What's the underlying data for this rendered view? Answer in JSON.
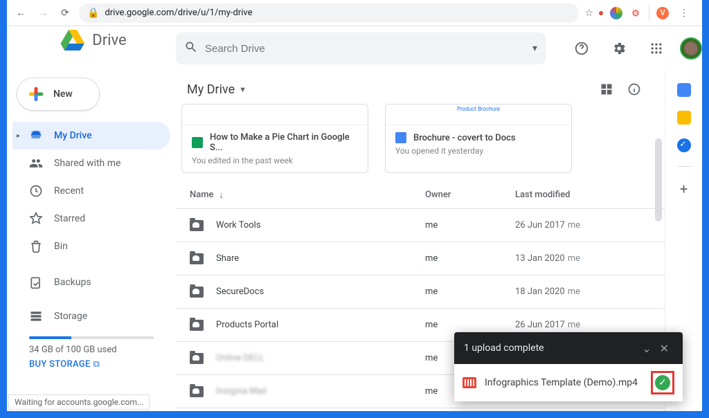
{
  "browser": {
    "url": "drive.google.com/drive/u/1/my-drive",
    "avatar_letter": "V",
    "status": "Waiting for accounts.google.com..."
  },
  "brand": {
    "name": "Drive"
  },
  "search": {
    "placeholder": "Search Drive"
  },
  "new_button": "New",
  "nav": {
    "my_drive": "My Drive",
    "shared": "Shared with me",
    "recent": "Recent",
    "starred": "Starred",
    "bin": "Bin",
    "backups": "Backups",
    "storage_label": "Storage",
    "storage_used": "34 GB of 100 GB used",
    "storage_pct": 34,
    "buy": "BUY STORAGE"
  },
  "location": "My Drive",
  "quick": [
    {
      "icon": "sheet",
      "title": "How to Make a Pie Chart in Google S...",
      "sub": "You edited in the past week",
      "thumb": ""
    },
    {
      "icon": "doc",
      "title": "Brochure - covert to Docs",
      "sub": "You opened it yesterday",
      "thumb": "Product Brochure"
    }
  ],
  "columns": {
    "name": "Name",
    "owner": "Owner",
    "modified": "Last modified"
  },
  "rows": [
    {
      "name": "Work Tools",
      "owner": "me",
      "modified": "26 Jun 2017",
      "owner2": "me",
      "shared": true
    },
    {
      "name": "Share",
      "owner": "me",
      "modified": "13 Jan 2020",
      "owner2": "me",
      "shared": true
    },
    {
      "name": "SecureDocs",
      "owner": "me",
      "modified": "18 Jan 2020",
      "owner2": "me",
      "shared": true
    },
    {
      "name": "Products Portal",
      "owner": "me",
      "modified": "26 Jun 2017",
      "owner2": "me",
      "shared": true
    },
    {
      "name": "Online DELL",
      "owner": "me",
      "modified": "",
      "owner2": "",
      "shared": true,
      "blur": true
    },
    {
      "name": "Insignia Mail",
      "owner": "me",
      "modified": "",
      "owner2": "",
      "shared": true,
      "blur": true
    }
  ],
  "toast": {
    "title": "1 upload complete",
    "file": "Infographics Template (Demo).mp4"
  }
}
